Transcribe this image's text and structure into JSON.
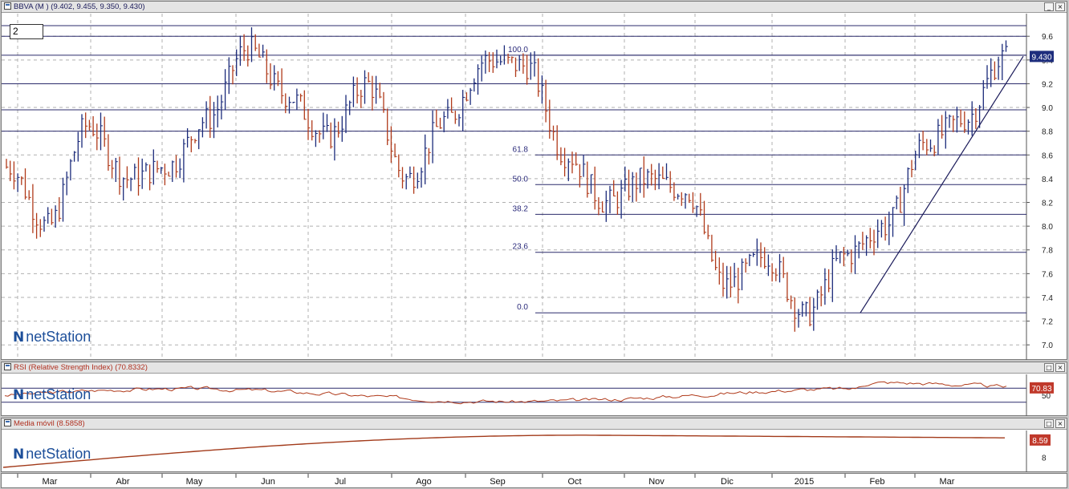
{
  "main_panel": {
    "title": "BBVA (M )",
    "ohlc": "(9.402, 9.455, 9.350, 9.430)",
    "period_value": "2",
    "last_price_label": "9.430",
    "y_ticks": [
      "9.6",
      "9.4",
      "9.2",
      "9.0",
      "8.8",
      "8.6",
      "8.4",
      "8.2",
      "8.0",
      "7.8",
      "7.6",
      "7.4",
      "7.2",
      "7.0"
    ],
    "fib_labels": [
      "100.0",
      "61.8",
      "50.0",
      "38.2",
      "23.6",
      "0.0"
    ],
    "buttons": {
      "minimize": "_",
      "close": "×"
    }
  },
  "rsi_panel": {
    "title": "RSI (Relative Strength Index)",
    "value": "(70.8332)",
    "last_label": "70.83",
    "y_ticks": [
      "50"
    ],
    "buttons": {
      "maximize": "□",
      "close": "×"
    }
  },
  "ma_panel": {
    "title": "Media móvil",
    "value": "(8.5858)",
    "last_label": "8.59",
    "y_ticks": [
      "8"
    ],
    "buttons": {
      "maximize": "□",
      "close": "×"
    }
  },
  "x_axis": {
    "months": [
      "Mar",
      "Abr",
      "May",
      "Jun",
      "Jul",
      "Ago",
      "Sep",
      "Oct",
      "Nov",
      "Dic",
      "2015",
      "Feb",
      "Mar"
    ]
  },
  "logo_text": "netStation",
  "colors": {
    "up_bar": "#1a2a7a",
    "down_bar": "#b03a1a",
    "hlines": "#2b2b6b",
    "rsi_line": "#b03a1a",
    "ma_line": "#a23a1a",
    "price_label_bg": "#1d2d7d",
    "rsi_label_bg": "#c0392b",
    "grid": "#b0b0b0"
  },
  "chart_data": {
    "type": "bar",
    "title": "BBVA (M )",
    "subtitle": "(9.402, 9.455, 9.350, 9.430)",
    "x_range": [
      "Mar 2014",
      "Mar 2015"
    ],
    "ylim": [
      6.9,
      9.75
    ],
    "grid": true,
    "series": [
      {
        "name": "BBVA",
        "kind": "ohlc_bars",
        "monthly_path": [
          {
            "x": "Mar",
            "y": 8.5
          },
          {
            "x": "Mar-end",
            "y": 8.0
          },
          {
            "x": "Abr",
            "y": 8.85
          },
          {
            "x": "Abr-mid",
            "y": 8.4
          },
          {
            "x": "May",
            "y": 8.5
          },
          {
            "x": "May-end",
            "y": 8.9
          },
          {
            "x": "Jun",
            "y": 9.5
          },
          {
            "x": "Jun-end",
            "y": 9.1
          },
          {
            "x": "Jul",
            "y": 8.75
          },
          {
            "x": "Jul-end",
            "y": 9.2
          },
          {
            "x": "Ago",
            "y": 8.4
          },
          {
            "x": "Ago-end",
            "y": 8.9
          },
          {
            "x": "Sep",
            "y": 9.4
          },
          {
            "x": "Sep-end",
            "y": 9.35
          },
          {
            "x": "Oct",
            "y": 8.6
          },
          {
            "x": "Oct-mid",
            "y": 8.2
          },
          {
            "x": "Nov",
            "y": 8.4
          },
          {
            "x": "Nov-end",
            "y": 8.3
          },
          {
            "x": "Dic",
            "y": 7.5
          },
          {
            "x": "Dic-end",
            "y": 7.75
          },
          {
            "x": "2015",
            "y": 7.25
          },
          {
            "x": "Ene-mid",
            "y": 7.75
          },
          {
            "x": "Feb",
            "y": 8.0
          },
          {
            "x": "Feb-end",
            "y": 8.7
          },
          {
            "x": "Mar",
            "y": 8.9
          },
          {
            "x": "Mar-end",
            "y": 9.43
          }
        ],
        "last": {
          "open": 9.402,
          "high": 9.455,
          "low": 9.35,
          "close": 9.43
        }
      }
    ],
    "horizontal_levels": [
      9.6,
      9.44,
      9.2,
      8.98,
      8.8
    ],
    "fibonacci": [
      {
        "label": "100.0",
        "value": 9.44
      },
      {
        "label": "61.8",
        "value": 8.6
      },
      {
        "label": "50.0",
        "value": 8.35
      },
      {
        "label": "38.2",
        "value": 8.1
      },
      {
        "label": "23.6",
        "value": 7.78
      },
      {
        "label": "0.0",
        "value": 7.27
      }
    ],
    "trendline": {
      "from": {
        "x": "Ene-end",
        "y": 7.27
      },
      "to": {
        "x": "Mar-end",
        "y": 9.35
      }
    },
    "indicators": [
      {
        "name": "RSI (Relative Strength Index)",
        "last": 70.8332,
        "ylim": [
          0,
          100
        ],
        "levels": [
          70,
          30
        ]
      },
      {
        "name": "Media móvil",
        "last": 8.5858
      }
    ]
  }
}
